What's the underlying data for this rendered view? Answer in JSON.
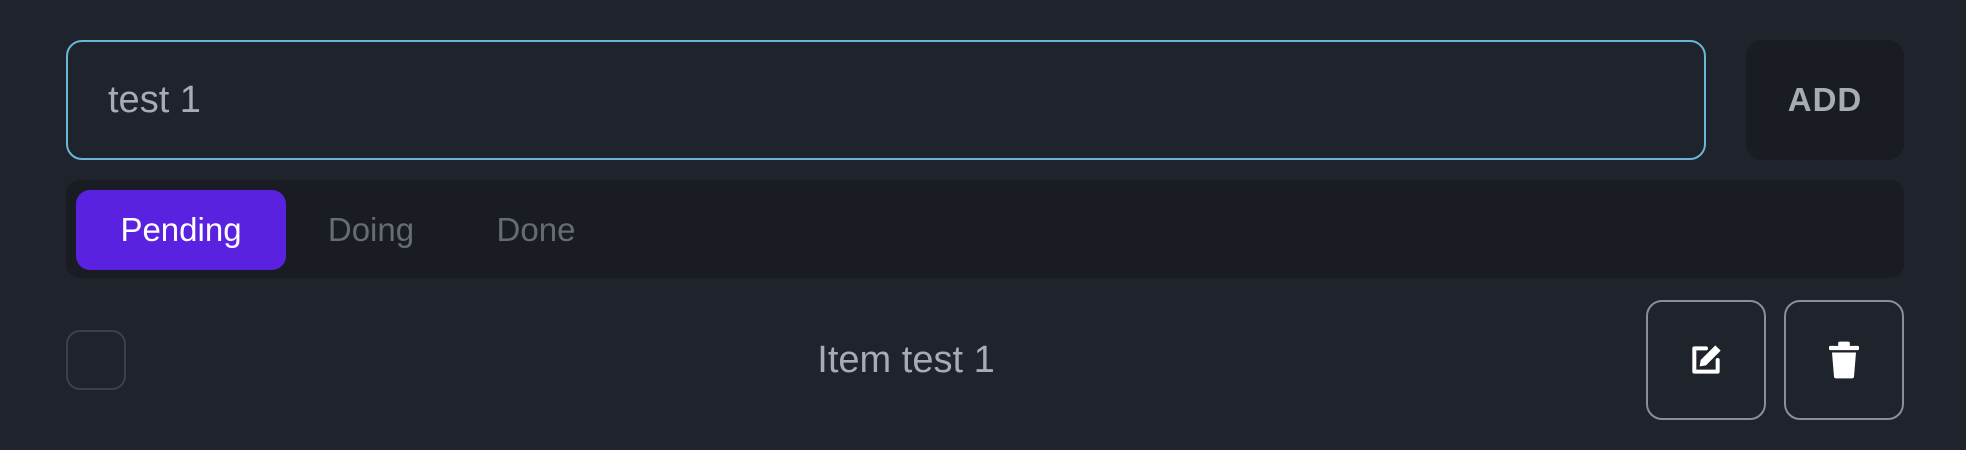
{
  "new_task": {
    "value": "test 1",
    "add_label": "ADD"
  },
  "tabs": [
    {
      "label": "Pending",
      "active": true
    },
    {
      "label": "Doing",
      "active": false
    },
    {
      "label": "Done",
      "active": false
    }
  ],
  "items": [
    {
      "label": "Item test 1",
      "checked": false,
      "edit_icon": "edit-icon",
      "delete_icon": "trash-icon"
    }
  ],
  "colors": {
    "background": "#1f232b",
    "panel": "#191c22",
    "accent": "#5b21e0",
    "focus_border": "#6cb6d9",
    "muted_text": "#a6abb4",
    "inactive_tab_text": "#666b74"
  }
}
